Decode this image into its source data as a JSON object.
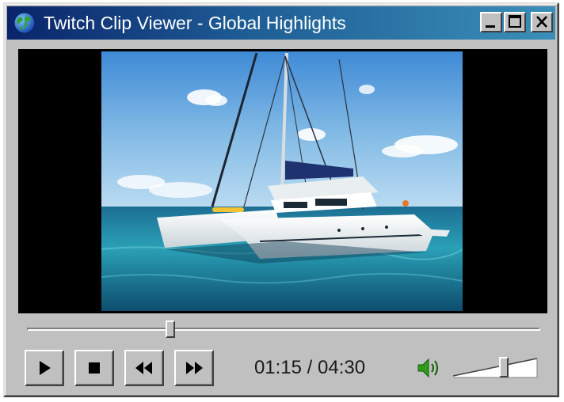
{
  "window": {
    "title": "Twitch Clip Viewer - Global Highlights",
    "app_icon": "globe-icon",
    "buttons": {
      "minimize": "minimize-icon",
      "maximize": "maximize-icon",
      "close": "close-icon"
    }
  },
  "video": {
    "frame_content": "catamaran-on-sea"
  },
  "playback": {
    "position_fraction": 0.28,
    "timecode": "01:15 / 04:30"
  },
  "controls": {
    "play": "play-icon",
    "stop": "stop-icon",
    "rewind": "rewind-icon",
    "fast_forward": "fast-forward-icon"
  },
  "volume": {
    "icon": "speaker-icon",
    "level_fraction": 0.6
  },
  "colors": {
    "titlebar_start": "#0a246a",
    "titlebar_end": "#3a8fb8",
    "chrome": "#c0c0c0",
    "speaker": "#2e9a1a"
  }
}
